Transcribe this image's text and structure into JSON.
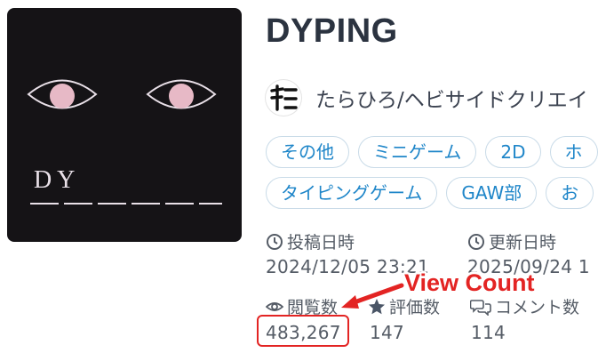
{
  "game": {
    "title": "DYPING",
    "thumbnail_text": "D Y",
    "author": "たらひろ/ヘビサイドクリエイ",
    "tags_row1": [
      "その他",
      "ミニゲーム",
      "2D",
      "ホ"
    ],
    "tags_row2": [
      "タイピングゲーム",
      "GAW部",
      "お"
    ]
  },
  "meta": {
    "posted_label": "投稿日時",
    "posted_value": "2024/12/05 23:21",
    "updated_label": "更新日時",
    "updated_value": "2025/09/24 1",
    "views_label": "閲覧数",
    "views_value": "483,267",
    "rating_label": "評価数",
    "rating_value": "147",
    "comments_label": "コメント数",
    "comments_value": "114"
  },
  "annotation": {
    "label": "View Count",
    "color": "#e32423"
  },
  "colors": {
    "tag_text": "#1f86c9",
    "tag_border": "#c9dbe8",
    "thumbnail_bg": "#151316"
  }
}
